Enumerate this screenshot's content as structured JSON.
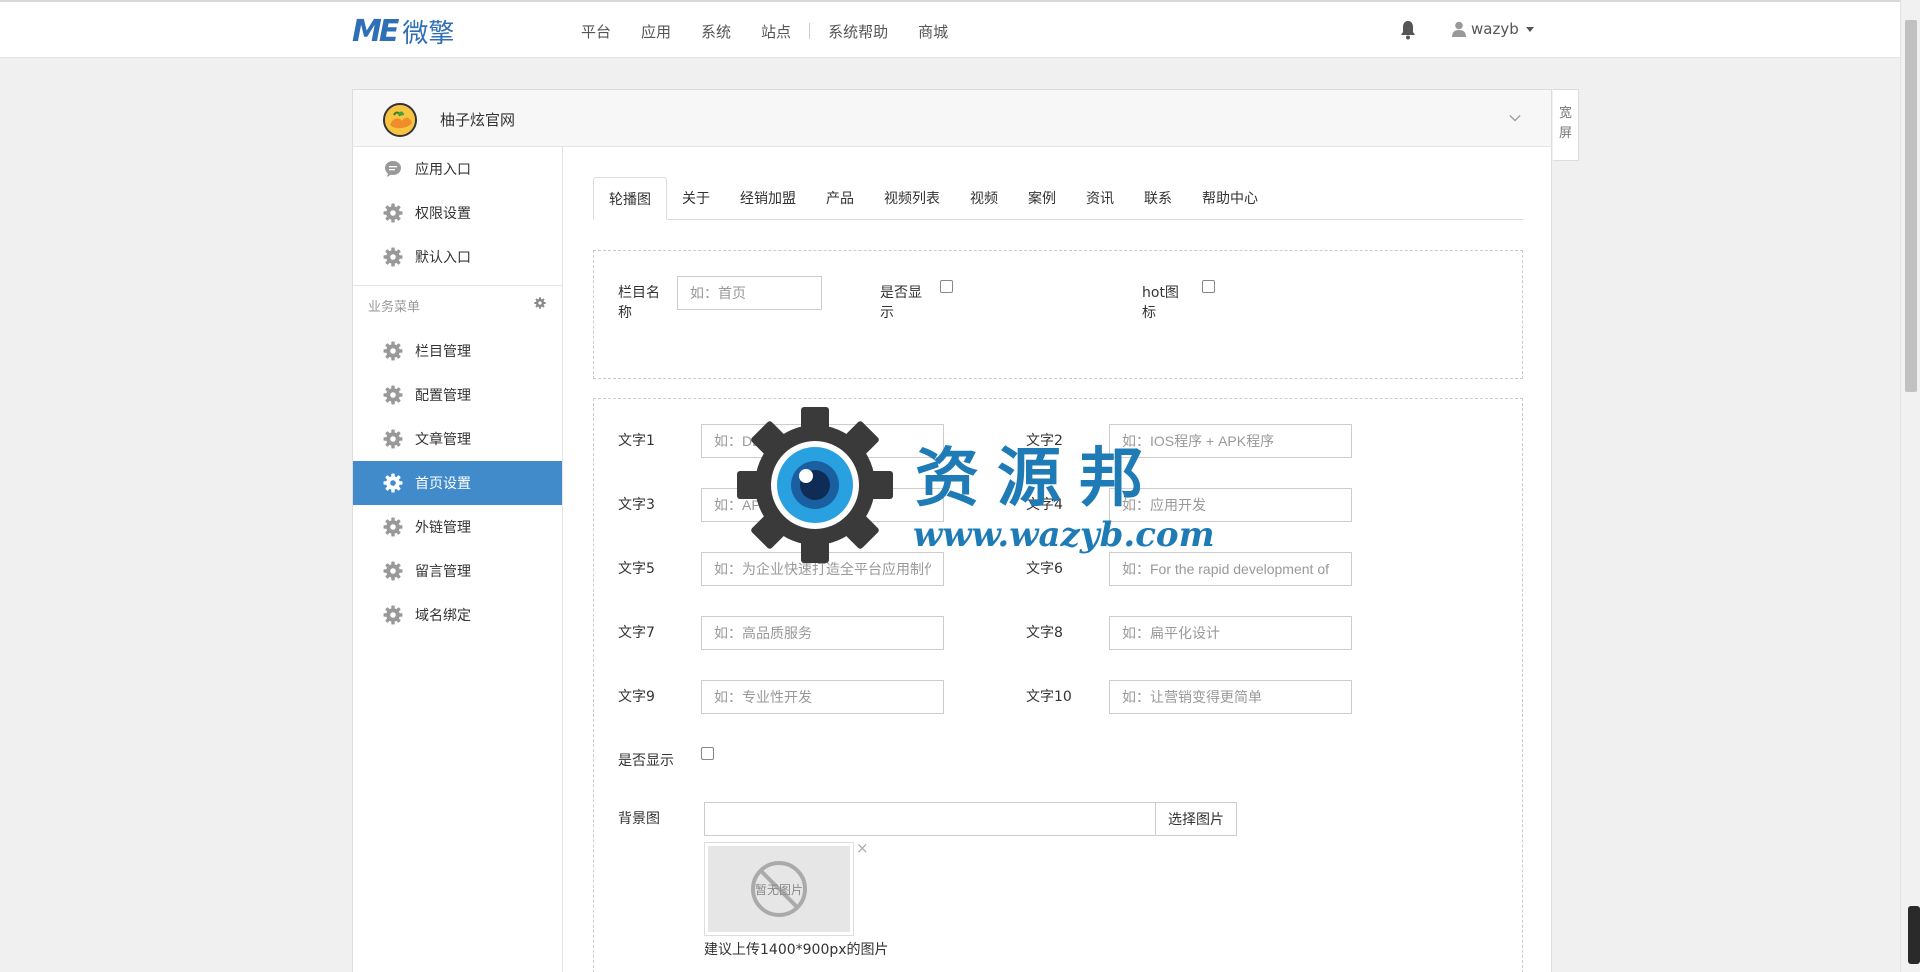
{
  "navbar": {
    "logo_mark": "ME",
    "logo_text": "微擎",
    "links": [
      "平台",
      "应用",
      "系统",
      "站点",
      "系统帮助",
      "商城"
    ],
    "username": "wazyb"
  },
  "site": {
    "name": "柚子炫官网",
    "wide_label": "宽屏"
  },
  "sidebar": {
    "top_items": [
      {
        "label": "应用入口",
        "icon": "chat-bubble-icon"
      },
      {
        "label": "权限设置",
        "icon": "gear-icon"
      },
      {
        "label": "默认入口",
        "icon": "gear-icon"
      }
    ],
    "group_title": "业务菜单",
    "items": [
      {
        "label": "栏目管理"
      },
      {
        "label": "配置管理"
      },
      {
        "label": "文章管理"
      },
      {
        "label": "首页设置"
      },
      {
        "label": "外链管理"
      },
      {
        "label": "留言管理"
      },
      {
        "label": "域名绑定"
      }
    ],
    "active_item": "首页设置"
  },
  "tabs": [
    "轮播图",
    "关于",
    "经销加盟",
    "产品",
    "视频列表",
    "视频",
    "案例",
    "资讯",
    "联系",
    "帮助中心"
  ],
  "section1": {
    "column_name_label": "栏目名称",
    "column_name_placeholder": "如：首页",
    "show_label": "是否显示",
    "hot_label": "hot图标"
  },
  "section2": {
    "fields": [
      {
        "label": "文字1",
        "placeholder": "如：DEVELOPMENT"
      },
      {
        "label": "文字2",
        "placeholder": "如：IOS程序 + APK程序"
      },
      {
        "label": "文字3",
        "placeholder": "如：APP"
      },
      {
        "label": "文字4",
        "placeholder": "如：应用开发"
      },
      {
        "label": "文字5",
        "placeholder": "如：为企业快速打造全平台应用制作"
      },
      {
        "label": "文字6",
        "placeholder": "如：For the rapid development of"
      },
      {
        "label": "文字7",
        "placeholder": "如：高品质服务"
      },
      {
        "label": "文字8",
        "placeholder": "如：扁平化设计"
      },
      {
        "label": "文字9",
        "placeholder": "如：专业性开发"
      },
      {
        "label": "文字10",
        "placeholder": "如：让营销变得更简单"
      }
    ],
    "show_label": "是否显示",
    "bg_label": "背景图",
    "select_image_label": "选择图片",
    "no_image_text": "暂无图片",
    "close_mark": "×",
    "hint": "建议上传1400*900px的图片"
  },
  "watermark": {
    "cn": "资源邦",
    "url": "www.wazyb.com"
  },
  "colors": {
    "brand": "#2f6fb5",
    "active_bg": "#428bca",
    "watermark": "#1e7bb5"
  }
}
